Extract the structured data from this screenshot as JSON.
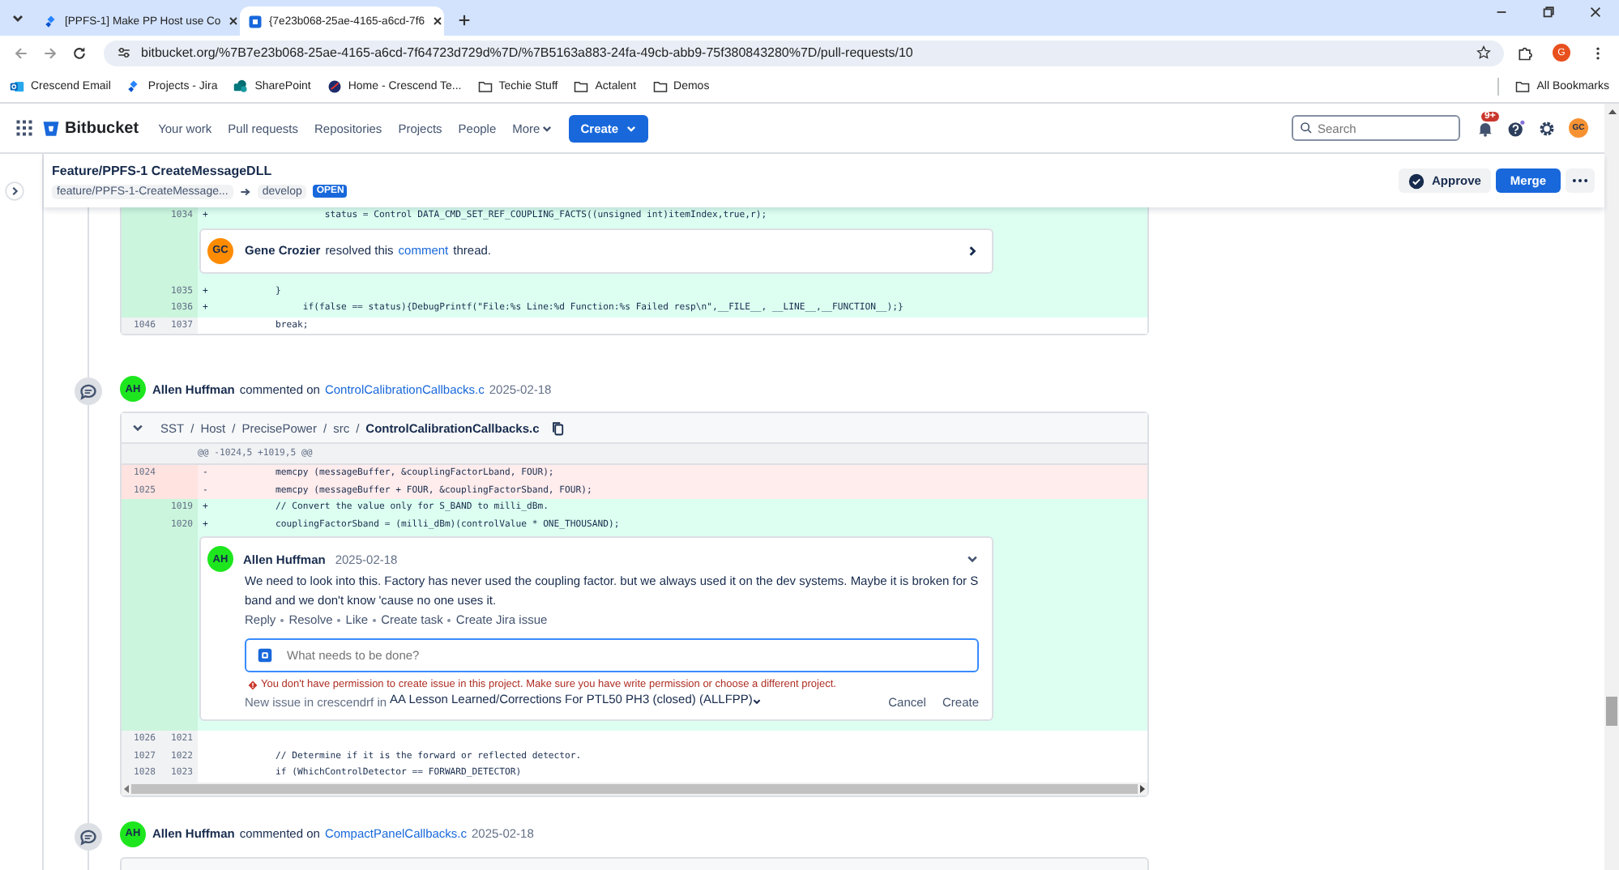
{
  "browser": {
    "tabs": [
      {
        "title": "[PPFS-1] Make PP Host use Co",
        "selected": false
      },
      {
        "title": "{7e23b068-25ae-4165-a6cd-7f6",
        "selected": true
      }
    ],
    "url": "bitbucket.org/%7B7e23b068-25ae-4165-a6cd-7f64723d729d%7D/%7B5163a883-24fa-49cb-abb9-75f380843280%7D/pull-requests/10",
    "profile": "G",
    "bookmarks": [
      {
        "label": "Crescend Email",
        "kind": "mail"
      },
      {
        "label": "Projects - Jira",
        "kind": "jira"
      },
      {
        "label": "SharePoint",
        "kind": "sharepoint"
      },
      {
        "label": "Home - Crescend Te...",
        "kind": "globe"
      },
      {
        "label": "Techie Stuff",
        "kind": "folder"
      },
      {
        "label": "Actalent",
        "kind": "folder"
      },
      {
        "label": "Demos",
        "kind": "folder"
      }
    ],
    "all_bookmarks": "All Bookmarks"
  },
  "nav": {
    "product": "Bitbucket",
    "items": [
      "Your work",
      "Pull requests",
      "Repositories",
      "Projects",
      "People",
      "More"
    ],
    "create": "Create",
    "search_placeholder": "Search",
    "notification_badge": "9+",
    "avatar": "GC"
  },
  "pr": {
    "title": "Feature/PPFS-1 CreateMessageDLL",
    "source_branch": "feature/PPFS-1-CreateMessage...",
    "target_branch": "develop",
    "status": "OPEN",
    "approve": "Approve",
    "merge": "Merge"
  },
  "activity": [
    {
      "rows": [
        {
          "kind": "added",
          "new": "1034",
          "marker": "+",
          "code": "                    status = Control DATA_CMD_SET_REF_COUPLING_FACTS((unsigned int)itemIndex,true,r);"
        },
        {
          "kind": "resolved",
          "avatar": {
            "initials": "GC",
            "color": "#ff8b00"
          },
          "author": "Gene Crozier",
          "before": "resolved this",
          "link": "comment",
          "after": "thread."
        },
        {
          "kind": "added",
          "new": "1035",
          "marker": "+",
          "code": "           }"
        },
        {
          "kind": "added",
          "new": "1036",
          "marker": "+",
          "code": "                if(false == status){DebugPrintf(\"File:%s Line:%d Function:%s Failed resp\\n\",__FILE__, __LINE__,__FUNCTION__);}"
        },
        {
          "kind": "context",
          "old": "1046",
          "new": "1037",
          "code": "           break;"
        }
      ]
    },
    {
      "header": {
        "avatar": {
          "initials": "AH",
          "color": "#1ee61e"
        },
        "author": "Allen Huffman",
        "verb": "commented on",
        "file": "ControlCalibrationCallbacks.c",
        "date": "2025-02-18"
      },
      "path": [
        "SST",
        "Host",
        "PrecisePower",
        "src",
        "ControlCalibrationCallbacks.c"
      ],
      "path_separator": "/",
      "hunk": "@@ -1024,5 +1019,5 @@",
      "rows": [
        {
          "kind": "removed",
          "old": "1024",
          "marker": "-",
          "code": "           memcpy (messageBuffer, &couplingFactorLband, FOUR);"
        },
        {
          "kind": "removed",
          "old": "1025",
          "marker": "-",
          "code": "           memcpy (messageBuffer + FOUR, &couplingFactorSband, FOUR);"
        },
        {
          "kind": "added",
          "new": "1019",
          "marker": "+",
          "code": "           // Convert the value only for S_BAND to milli_dBm."
        },
        {
          "kind": "added",
          "new": "1020",
          "marker": "+",
          "code": "           couplingFactorSband = (milli_dBm)(controlValue * ONE_THOUSAND);"
        },
        {
          "kind": "comment",
          "avatar": {
            "initials": "AH",
            "color": "#1ee61e"
          },
          "author": "Allen Huffman",
          "date": "2025-02-18",
          "text": "We need to look into this. Factory has never used the coupling factor. but we always used it on the dev systems. Maybe it is broken for S band and we don't know 'cause no one uses it.",
          "actions": [
            "Reply",
            "Resolve",
            "Like",
            "Create task",
            "Create Jira issue"
          ],
          "jira": {
            "placeholder": "What needs to be done?",
            "error": "You don't have permission to create issue in this project. Make sure you have write permission or choose a different project.",
            "project_label": "New issue in crescendrf in",
            "project": "AA Lesson Learned/Corrections For PTL50 PH3 (closed) (ALLFPP)",
            "cancel": "Cancel",
            "create": "Create"
          }
        },
        {
          "kind": "context",
          "old": "1026",
          "new": "1021"
        },
        {
          "kind": "context",
          "old": "1027",
          "new": "1022",
          "code": "           // Determine if it is the forward or reflected detector."
        },
        {
          "kind": "context",
          "old": "1028",
          "new": "1023",
          "code": "           if (WhichControlDetector == FORWARD_DETECTOR)"
        }
      ]
    },
    {
      "header": {
        "avatar": {
          "initials": "AH",
          "color": "#1ee61e"
        },
        "author": "Allen Huffman",
        "verb": "commented on",
        "file": "CompactPanelCallbacks.c",
        "date": "2025-02-18"
      }
    }
  ]
}
